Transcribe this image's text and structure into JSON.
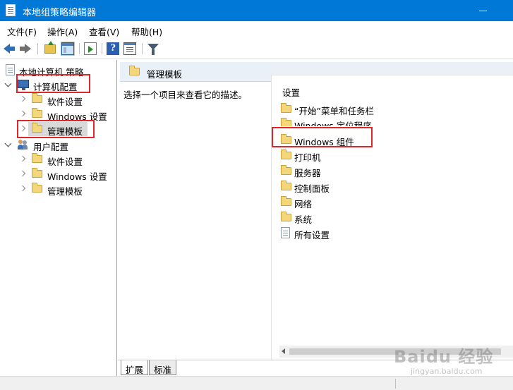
{
  "window": {
    "title": "本地组策略编辑器",
    "accent_color": "#0078d7"
  },
  "menu": [
    {
      "label": "文件(F)"
    },
    {
      "label": "操作(A)"
    },
    {
      "label": "查看(V)"
    },
    {
      "label": "帮助(H)"
    }
  ],
  "toolbar": {
    "icons": [
      "back-arrow-icon",
      "forward-arrow-icon",
      "folder-up-icon",
      "show-hide-tree-icon",
      "export-list-icon",
      "help-icon",
      "properties-icon",
      "filter-icon"
    ]
  },
  "tree": {
    "root": "本地计算机 策略",
    "computer_config": "计算机配置",
    "computer_children": [
      "软件设置",
      "Windows 设置",
      "管理模板"
    ],
    "user_config": "用户配置",
    "user_children": [
      "软件设置",
      "Windows 设置",
      "管理模板"
    ]
  },
  "right": {
    "header": "管理模板",
    "description": "选择一个项目来查看它的描述。",
    "column_header": "设置",
    "items": [
      {
        "label": "“开始”菜单和任务栏",
        "icon": "folder-icon"
      },
      {
        "label": "Windows 定位程序",
        "icon": "folder-icon"
      },
      {
        "label": "Windows 组件",
        "icon": "folder-icon"
      },
      {
        "label": "打印机",
        "icon": "folder-icon"
      },
      {
        "label": "服务器",
        "icon": "folder-icon"
      },
      {
        "label": "控制面板",
        "icon": "folder-icon"
      },
      {
        "label": "网络",
        "icon": "folder-icon"
      },
      {
        "label": "系统",
        "icon": "folder-icon"
      },
      {
        "label": "所有设置",
        "icon": "all-settings-icon"
      }
    ]
  },
  "tabs": [
    {
      "label": "扩展"
    },
    {
      "label": "标准"
    }
  ],
  "watermark": {
    "brand": "Baidu 经验",
    "sub": "jingyan.baidu.com"
  },
  "highlight_color": "#e0262b"
}
